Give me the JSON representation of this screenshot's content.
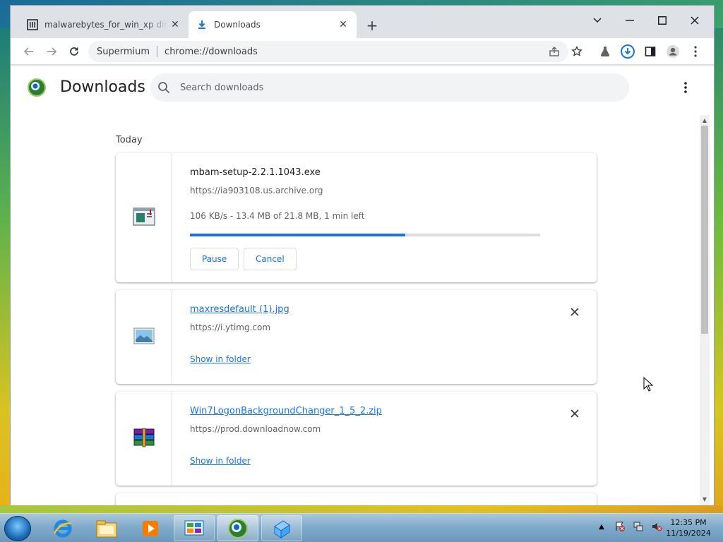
{
  "browser": {
    "tabs": [
      {
        "title": "malwarebytes_for_win_xp directory listing",
        "active": false
      },
      {
        "title": "Downloads",
        "active": true
      }
    ],
    "omnibox": {
      "site": "Supermium",
      "url": "chrome://downloads"
    }
  },
  "downloads_page": {
    "title": "Downloads",
    "search_placeholder": "Search downloads",
    "section_date": "Today",
    "items": [
      {
        "filename": "mbam-setup-2.2.1.1043.exe",
        "source": "https://ia903108.us.archive.org",
        "status": "106 KB/s - 13.4 MB of 21.8 MB, 1 min left",
        "progress": 0.615,
        "buttons": [
          "Pause",
          "Cancel"
        ]
      },
      {
        "filename": "maxresdefault (1).jpg",
        "source": "https://i.ytimg.com",
        "link": "Show in folder"
      },
      {
        "filename": "Win7LogonBackgroundChanger_1_5_2.zip",
        "source": "https://prod.downloadnow.com",
        "link": "Show in folder"
      }
    ]
  },
  "taskbar": {
    "clock_time": "12:35 PM",
    "clock_date": "11/19/2024"
  },
  "colors": {
    "accent": "#1a73e8",
    "tab_strip": "#dee1e6",
    "taskbar": "#7ea9c9"
  }
}
